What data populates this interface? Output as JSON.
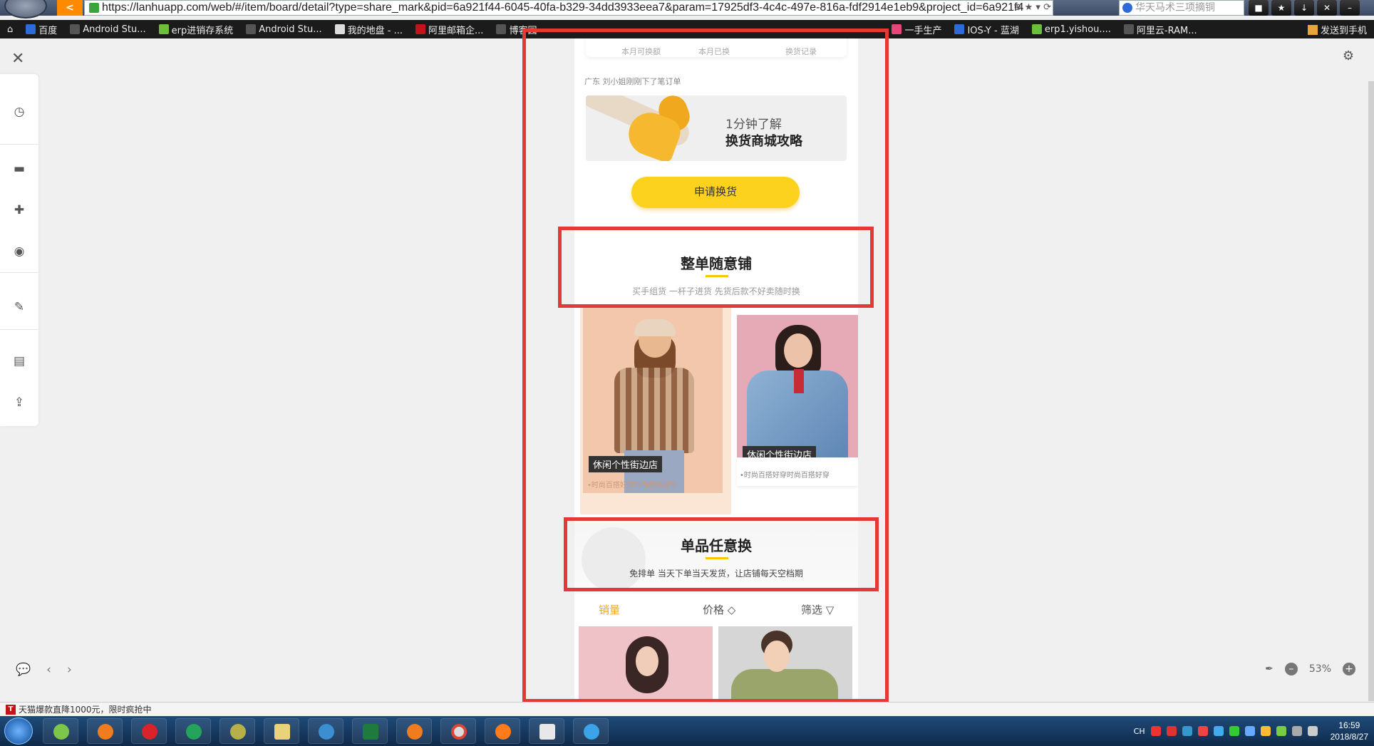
{
  "browser": {
    "url": "https://lanhuapp.com/web/#/item/board/detail?type=share_mark&pid=6a921f44-6045-40fa-b329-34dd3933eea7&param=17925df3-4c4c-497e-816a-fdf2914e1eb9&project_id=6a921f4",
    "search_placeholder": "华天马术三项摘铜"
  },
  "bookmarks": [
    {
      "label": "百度",
      "color": "#2f6bd8"
    },
    {
      "label": "Android Stu...",
      "color": "#555555"
    },
    {
      "label": "erp进销存系统",
      "color": "#6bbf3a"
    },
    {
      "label": "Android Stu...",
      "color": "#555555"
    },
    {
      "label": "我的地盘 - ...",
      "color": "#dddddd"
    },
    {
      "label": "阿里邮箱企...",
      "color": "#c4141b"
    },
    {
      "label": "博客园",
      "color": "#555555"
    },
    {
      "label": "一手生产",
      "color": "#e8457a"
    },
    {
      "label": "IOS-Y - 蓝湖",
      "color": "#2f6bd8"
    },
    {
      "label": "erp1.yishou....",
      "color": "#6bbf3a"
    },
    {
      "label": "阿里云-RAM...",
      "color": "#555555"
    }
  ],
  "bookmark_send": "发送到手机",
  "artboard": {
    "stats": [
      "本月可换额",
      "本月已换",
      "换货记录"
    ],
    "order_note": "广东 刘小姐刚刚下了笔订单",
    "banner_line1": "1分钟了解",
    "banner_line2": "换货商城攻略",
    "apply_button": "申请换货",
    "section1_title": "整单随意铺",
    "section1_sub": "买手组货 一杆子进货 先货后款不好卖随时换",
    "card1_tag": "休闲个性街边店",
    "card1_desc": "•时尚百搭好穿时尚百搭好穿",
    "card2_tag": "休闲个性街边店",
    "card2_desc": "•时尚百搭好穿时尚百搭好穿",
    "section2_title": "单品任意换",
    "section2_sub": "免排单 当天下单当天发货，让店铺每天空档期",
    "tabs": [
      "销量",
      "价格 ◇",
      "筛选 ▽"
    ]
  },
  "zoom": "53%",
  "status_text": "天猫爆款直降1000元，限时疯抢中",
  "clock_time": "16:59",
  "clock_date": "2018/8/27",
  "colors": {
    "accent": "#fcd21e",
    "annotation": "#e53935",
    "tab_active": "#f5a623"
  }
}
